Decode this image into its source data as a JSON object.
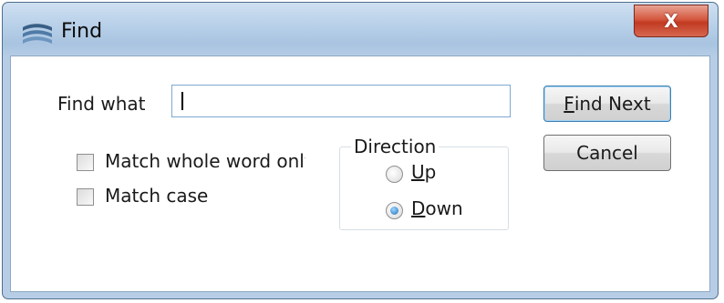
{
  "window": {
    "title": "Find",
    "close_label": "X"
  },
  "find": {
    "label": "Find what",
    "value": ""
  },
  "options": {
    "match_whole_word": {
      "label": "Match whole word only",
      "checked": false
    },
    "match_case": {
      "label": "Match case",
      "checked": false
    }
  },
  "direction": {
    "legend": "Direction",
    "up": {
      "mnemonic": "U",
      "rest": "p",
      "checked": false
    },
    "down": {
      "mnemonic": "D",
      "rest": "own",
      "checked": true
    }
  },
  "buttons": {
    "find_next": {
      "mnemonic": "F",
      "rest": "ind Next"
    },
    "cancel": "Cancel"
  },
  "icons": {
    "app": "app-logo-icon",
    "close": "close-icon",
    "radio_selected_color": "#1f6fb8"
  }
}
